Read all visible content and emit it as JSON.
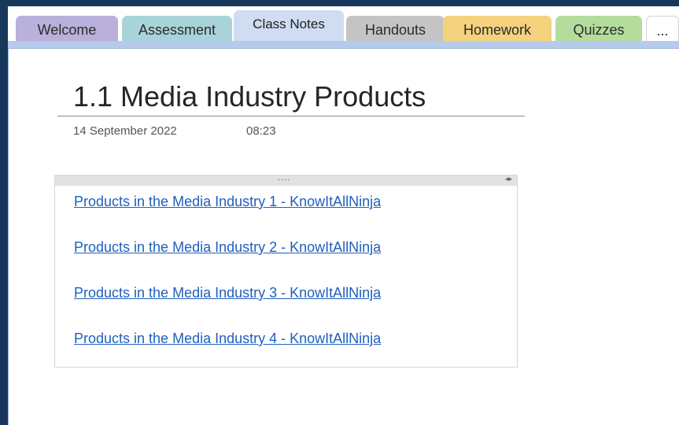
{
  "tabs": [
    {
      "label": "Welcome",
      "color": "#b9b0dc"
    },
    {
      "label": "Assessment",
      "color": "#a8d3d8"
    },
    {
      "label": "Class Notes",
      "color": "#cfdcf2",
      "active": true
    },
    {
      "label": "Handouts",
      "color": "#c4c4c4"
    },
    {
      "label": "Homework",
      "color": "#f4d27e"
    },
    {
      "label": "Quizzes",
      "color": "#b4dc9c"
    },
    {
      "label": "...",
      "color": "#ffffff"
    }
  ],
  "page": {
    "title": "1.1 Media Industry Products",
    "date": "14 September 2022",
    "time": "08:23"
  },
  "outline": {
    "drag_handle": "....",
    "resize_icon": "chevron-left-right-icon",
    "links": [
      "Products in the Media Industry 1 - KnowItAllNinja",
      "Products in the Media Industry 2 - KnowItAllNinja",
      "Products in the Media Industry 3 - KnowItAllNinja",
      "Products in the Media Industry 4 - KnowItAllNinja"
    ]
  },
  "colors": {
    "background": "#17385a",
    "link": "#1f5fbf",
    "active_tab_bar": "#b6cbeb"
  }
}
